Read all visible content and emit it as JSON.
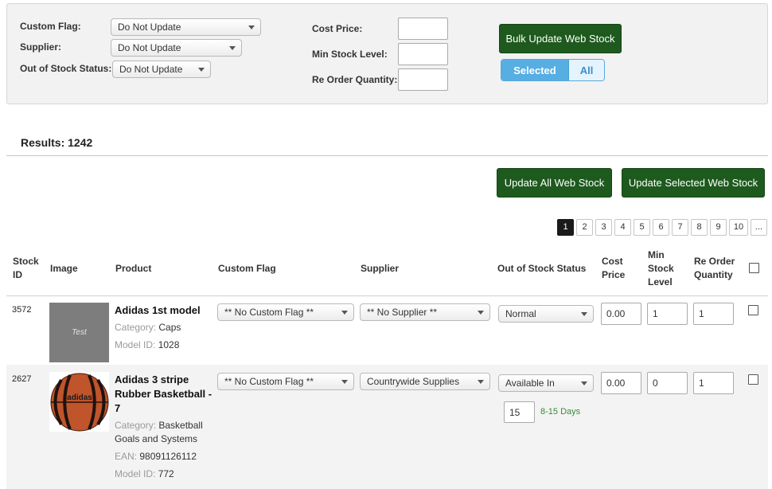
{
  "filters": {
    "custom_flag_label": "Custom Flag:",
    "custom_flag_value": "Do Not Update",
    "supplier_label": "Supplier:",
    "supplier_value": "Do Not Update",
    "out_of_stock_label": "Out of Stock Status:",
    "out_of_stock_value": "Do Not Update",
    "cost_price_label": "Cost Price:",
    "cost_price_value": "",
    "min_stock_label": "Min Stock Level:",
    "min_stock_value": "",
    "reorder_label": "Re Order Quantity:",
    "reorder_value": "",
    "bulk_update_label": "Bulk Update Web Stock",
    "scope_selected": "Selected",
    "scope_all": "All",
    "scope_active": "Selected"
  },
  "results_text": "Results: 1242",
  "actions": {
    "update_all_label": "Update All Web Stock",
    "update_selected_label": "Update Selected Web Stock"
  },
  "pagination": {
    "pages": [
      "1",
      "2",
      "3",
      "4",
      "5",
      "6",
      "7",
      "8",
      "9",
      "10",
      "..."
    ],
    "active": "1"
  },
  "table": {
    "headers": {
      "stock_id": [
        "Stock",
        "ID"
      ],
      "image": "Image",
      "product": "Product",
      "custom_flag": "Custom Flag",
      "supplier": "Supplier",
      "out_of_stock": "Out of Stock Status",
      "cost_price": [
        "Cost",
        "Price"
      ],
      "min_stock": [
        "Min",
        "Stock",
        "Level"
      ],
      "reorder": [
        "Re Order",
        "Quantity"
      ]
    },
    "rows": [
      {
        "stock_id": "3572",
        "image_text": "Test",
        "name": "Adidas 1st model",
        "category_label": "Category:",
        "category": "Caps",
        "model_label": "Model ID:",
        "model": "1028",
        "custom_flag": "** No Custom Flag **",
        "supplier": "** No Supplier **",
        "out_of_stock": "Normal",
        "cost_price": "0.00",
        "min_stock": "1",
        "reorder": "1"
      },
      {
        "stock_id": "2627",
        "image_icon": "basketball-image",
        "image_brand": "adidas",
        "name": "Adidas 3 stripe Rubber Basketball - 7",
        "category_label": "Category:",
        "category": "Basketball Goals and Systems",
        "ean_label": "EAN:",
        "ean": "98091126112",
        "model_label": "Model ID:",
        "model": "772",
        "custom_flag": "** No Custom Flag **",
        "supplier": "Countrywide Supplies",
        "out_of_stock": "Available In",
        "available_days_value": "15",
        "available_days_text": "8-15 Days",
        "cost_price": "0.00",
        "min_stock": "0",
        "reorder": "1"
      }
    ]
  },
  "colors": {
    "button_green": "#1e5a1e",
    "segment_blue": "#56aee3",
    "days_green": "#3a8a3a"
  }
}
